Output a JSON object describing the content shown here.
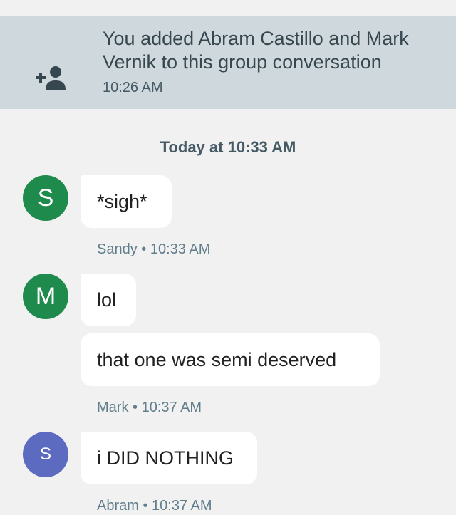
{
  "system_event": {
    "icon": "add-person-icon",
    "text": "You added Abram Castillo and Mark Vernik to this group conversation",
    "time": "10:26 AM"
  },
  "date_separator": "Today at 10:33 AM",
  "messages": [
    {
      "avatar_letter": "S",
      "avatar_color": "#1e8a4c",
      "bubbles": [
        "*sigh*"
      ],
      "sender": "Sandy",
      "time": "10:33 AM"
    },
    {
      "avatar_letter": "M",
      "avatar_color": "#1e8a4c",
      "bubbles": [
        "lol",
        "that one was semi deserved"
      ],
      "sender": "Mark",
      "time": "10:37 AM"
    },
    {
      "avatar_letter": "S",
      "avatar_color": "#5c6bc0",
      "bubbles": [
        "i DID NOTHING"
      ],
      "sender": "Abram",
      "time": "10:37 AM"
    }
  ],
  "meta_separator": "•",
  "colors": {
    "banner": "#cfd8dc",
    "background": "#f1f1f1",
    "green_avatar": "#1e8a4c",
    "blue_avatar": "#5c6bc0"
  }
}
